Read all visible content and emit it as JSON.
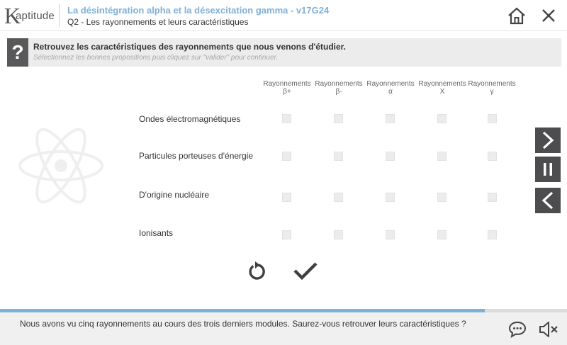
{
  "header": {
    "logo_k": "K",
    "logo_rest": "aptitude",
    "title": "La désintégration alpha et la désexcitation gamma - v17G24",
    "subtitle": "Q2 - Les rayonnements et leurs caractéristiques",
    "home_icon": "home-icon",
    "close_icon": "close-icon"
  },
  "question": {
    "icon": "?",
    "text": "Retrouvez les caractéristiques des rayonnements que nous venons d'étudier.",
    "hint": "Sélectionnez les bonnes propositions puis cliquez sur \"valider\" pour continuer."
  },
  "columns": [
    {
      "line1": "Rayonnements",
      "line2": "β+"
    },
    {
      "line1": "Rayonnements",
      "line2": "β-"
    },
    {
      "line1": "Rayonnements",
      "line2": "α"
    },
    {
      "line1": "Rayonnements",
      "line2": "X"
    },
    {
      "line1": "Rayonnements",
      "line2": "γ"
    }
  ],
  "rows": [
    {
      "label": "Ondes électromagnétiques",
      "checked": [
        false,
        false,
        false,
        false,
        false
      ]
    },
    {
      "label": "Particules porteuses d'énergie",
      "checked": [
        false,
        false,
        false,
        false,
        false
      ]
    },
    {
      "label": "D'origine nucléaire",
      "checked": [
        false,
        false,
        false,
        false,
        false
      ]
    },
    {
      "label": "Ionisants",
      "checked": [
        false,
        false,
        false,
        false,
        false
      ]
    }
  ],
  "side_nav": {
    "next_icon": "chevron-right-icon",
    "pause_icon": "pause-icon",
    "prev_icon": "chevron-left-icon"
  },
  "actions": {
    "reset_icon": "reset-icon",
    "validate_icon": "checkmark-icon"
  },
  "progress": 0.855,
  "footer": {
    "text": "Nous avons vu cinq rayonnements au cours des trois derniers modules. Saurez-vous retrouver leurs caractéristiques ?",
    "chat_icon": "chat-icon",
    "sound_icon": "speaker-icon"
  },
  "colors": {
    "accent": "#7fb0d6",
    "dark": "#4d4d4f",
    "checkbox": "#ececec"
  }
}
